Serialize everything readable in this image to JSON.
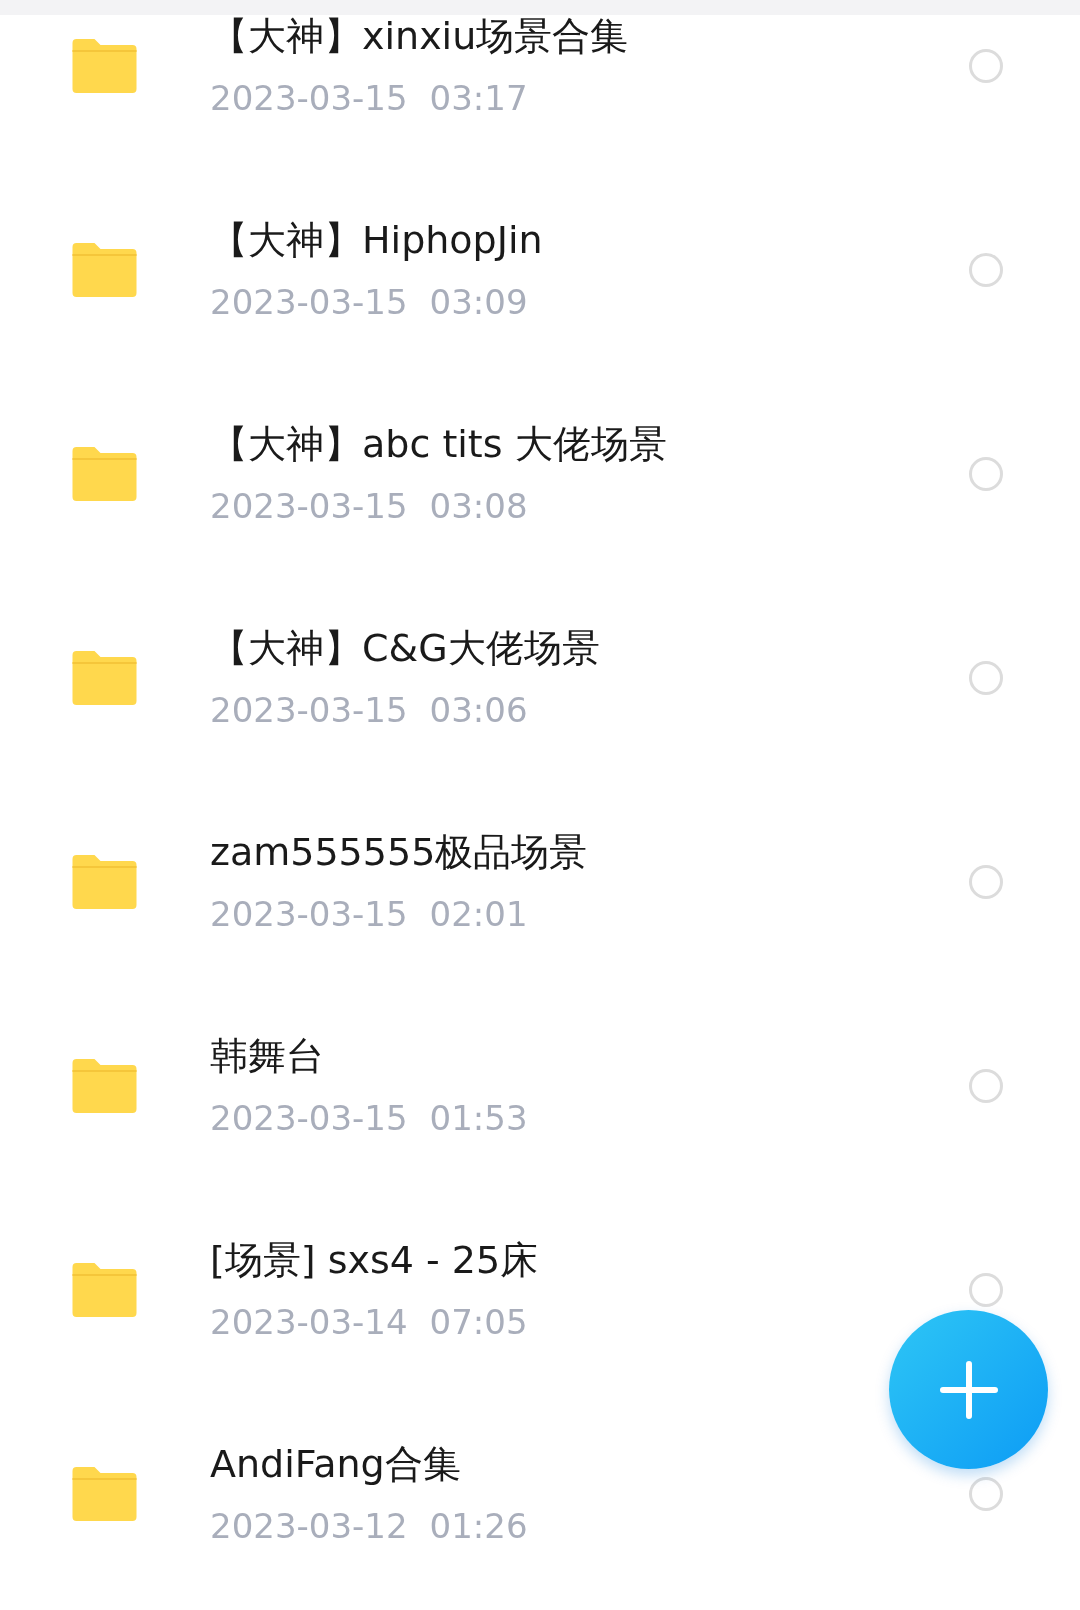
{
  "files": [
    {
      "title": "【大神】xinxiu场景合集",
      "date": "2023-03-15",
      "time": "03:17",
      "selected": false
    },
    {
      "title": "【大神】HiphopJin",
      "date": "2023-03-15",
      "time": "03:09",
      "selected": false
    },
    {
      "title": "【大神】abc tits 大佬场景",
      "date": "2023-03-15",
      "time": "03:08",
      "selected": false
    },
    {
      "title": "【大神】C&G大佬场景",
      "date": "2023-03-15",
      "time": "03:06",
      "selected": false
    },
    {
      "title": "zam555555极品场景",
      "date": "2023-03-15",
      "time": "02:01",
      "selected": false
    },
    {
      "title": "韩舞台",
      "date": "2023-03-15",
      "time": "01:53",
      "selected": false
    },
    {
      "title": "[场景] sxs4 - 25床",
      "date": "2023-03-14",
      "time": "07:05",
      "selected": false
    },
    {
      "title": "AndiFang合集",
      "date": "2023-03-12",
      "time": "01:26",
      "selected": false
    }
  ]
}
